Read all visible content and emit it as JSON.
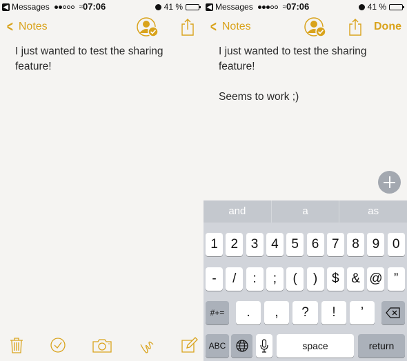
{
  "left": {
    "status": {
      "back_app": "Messages",
      "signal_filled": 2,
      "signal_total": 5,
      "time": "07:06",
      "battery": "41 %",
      "battery_level": 0.41
    },
    "nav": {
      "back_label": "Notes"
    },
    "note": {
      "lines": [
        "I just wanted to test the sharing feature!"
      ]
    },
    "toolbar": [
      "trash-icon",
      "checklist-icon",
      "camera-icon",
      "sketch-icon",
      "compose-icon"
    ]
  },
  "right": {
    "status": {
      "back_app": "Messages",
      "signal_filled": 3,
      "signal_total": 5,
      "time": "07:06",
      "battery": "41 %",
      "battery_level": 0.41
    },
    "nav": {
      "back_label": "Notes",
      "done_label": "Done"
    },
    "note": {
      "lines": [
        "I just wanted to test the sharing feature!",
        "Seems to work ;)"
      ]
    },
    "keyboard": {
      "predictions": [
        "and",
        "a",
        "as"
      ],
      "row1": [
        "1",
        "2",
        "3",
        "4",
        "5",
        "6",
        "7",
        "8",
        "9",
        "0"
      ],
      "row2": [
        "-",
        "/",
        ":",
        ";",
        "(",
        ")",
        "$",
        "&",
        "@",
        "”"
      ],
      "row3": {
        "shift": "#+=",
        "keys": [
          ".",
          ",",
          "?",
          "!",
          "’"
        ],
        "delete": "⌫"
      },
      "row4": {
        "abc": "ABC",
        "globe": "🌐",
        "mic": "🎙",
        "space": "space",
        "return": "return"
      }
    }
  },
  "colors": {
    "accent": "#d9a31c",
    "paper": "#f5f4f2",
    "keyboard_bg": "#d1d4da"
  }
}
